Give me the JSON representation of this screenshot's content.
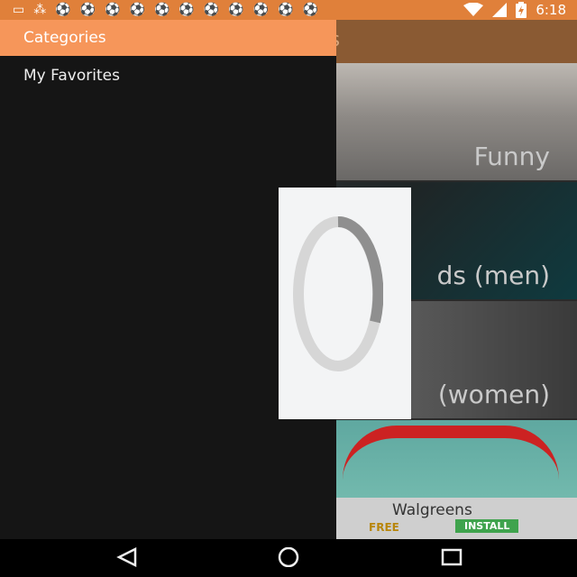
{
  "status_bar": {
    "time": "6:18",
    "left_icons": [
      "message-icon",
      "share-icon",
      "soccer-ball-icon",
      "soccer-ball-icon",
      "soccer-ball-icon",
      "soccer-ball-icon",
      "soccer-ball-icon",
      "soccer-ball-icon",
      "soccer-ball-icon",
      "soccer-ball-icon",
      "soccer-ball-icon",
      "soccer-ball-icon",
      "soccer-ball-icon"
    ],
    "right_icons": [
      "wifi-icon",
      "signal-icon",
      "battery-charging-icon"
    ]
  },
  "drawer": {
    "header_label": "Categories",
    "items": [
      {
        "label": "My Favorites"
      }
    ]
  },
  "background_app": {
    "title_partial": "otes",
    "categories": [
      {
        "label": "Funny"
      },
      {
        "label": "ds (men)"
      },
      {
        "label": "(women)"
      }
    ]
  },
  "ad": {
    "name": "Walgreens",
    "free_label": "FREE",
    "install_label": "INSTALL"
  },
  "loading": {
    "progress_arc": 0.28
  },
  "nav_bar": {
    "buttons": [
      "back",
      "home",
      "recents"
    ]
  },
  "colors": {
    "status_bar": "#e0803a",
    "drawer_header": "#f6965a",
    "drawer_bg": "#151515",
    "app_bar": "#8a5a33"
  }
}
